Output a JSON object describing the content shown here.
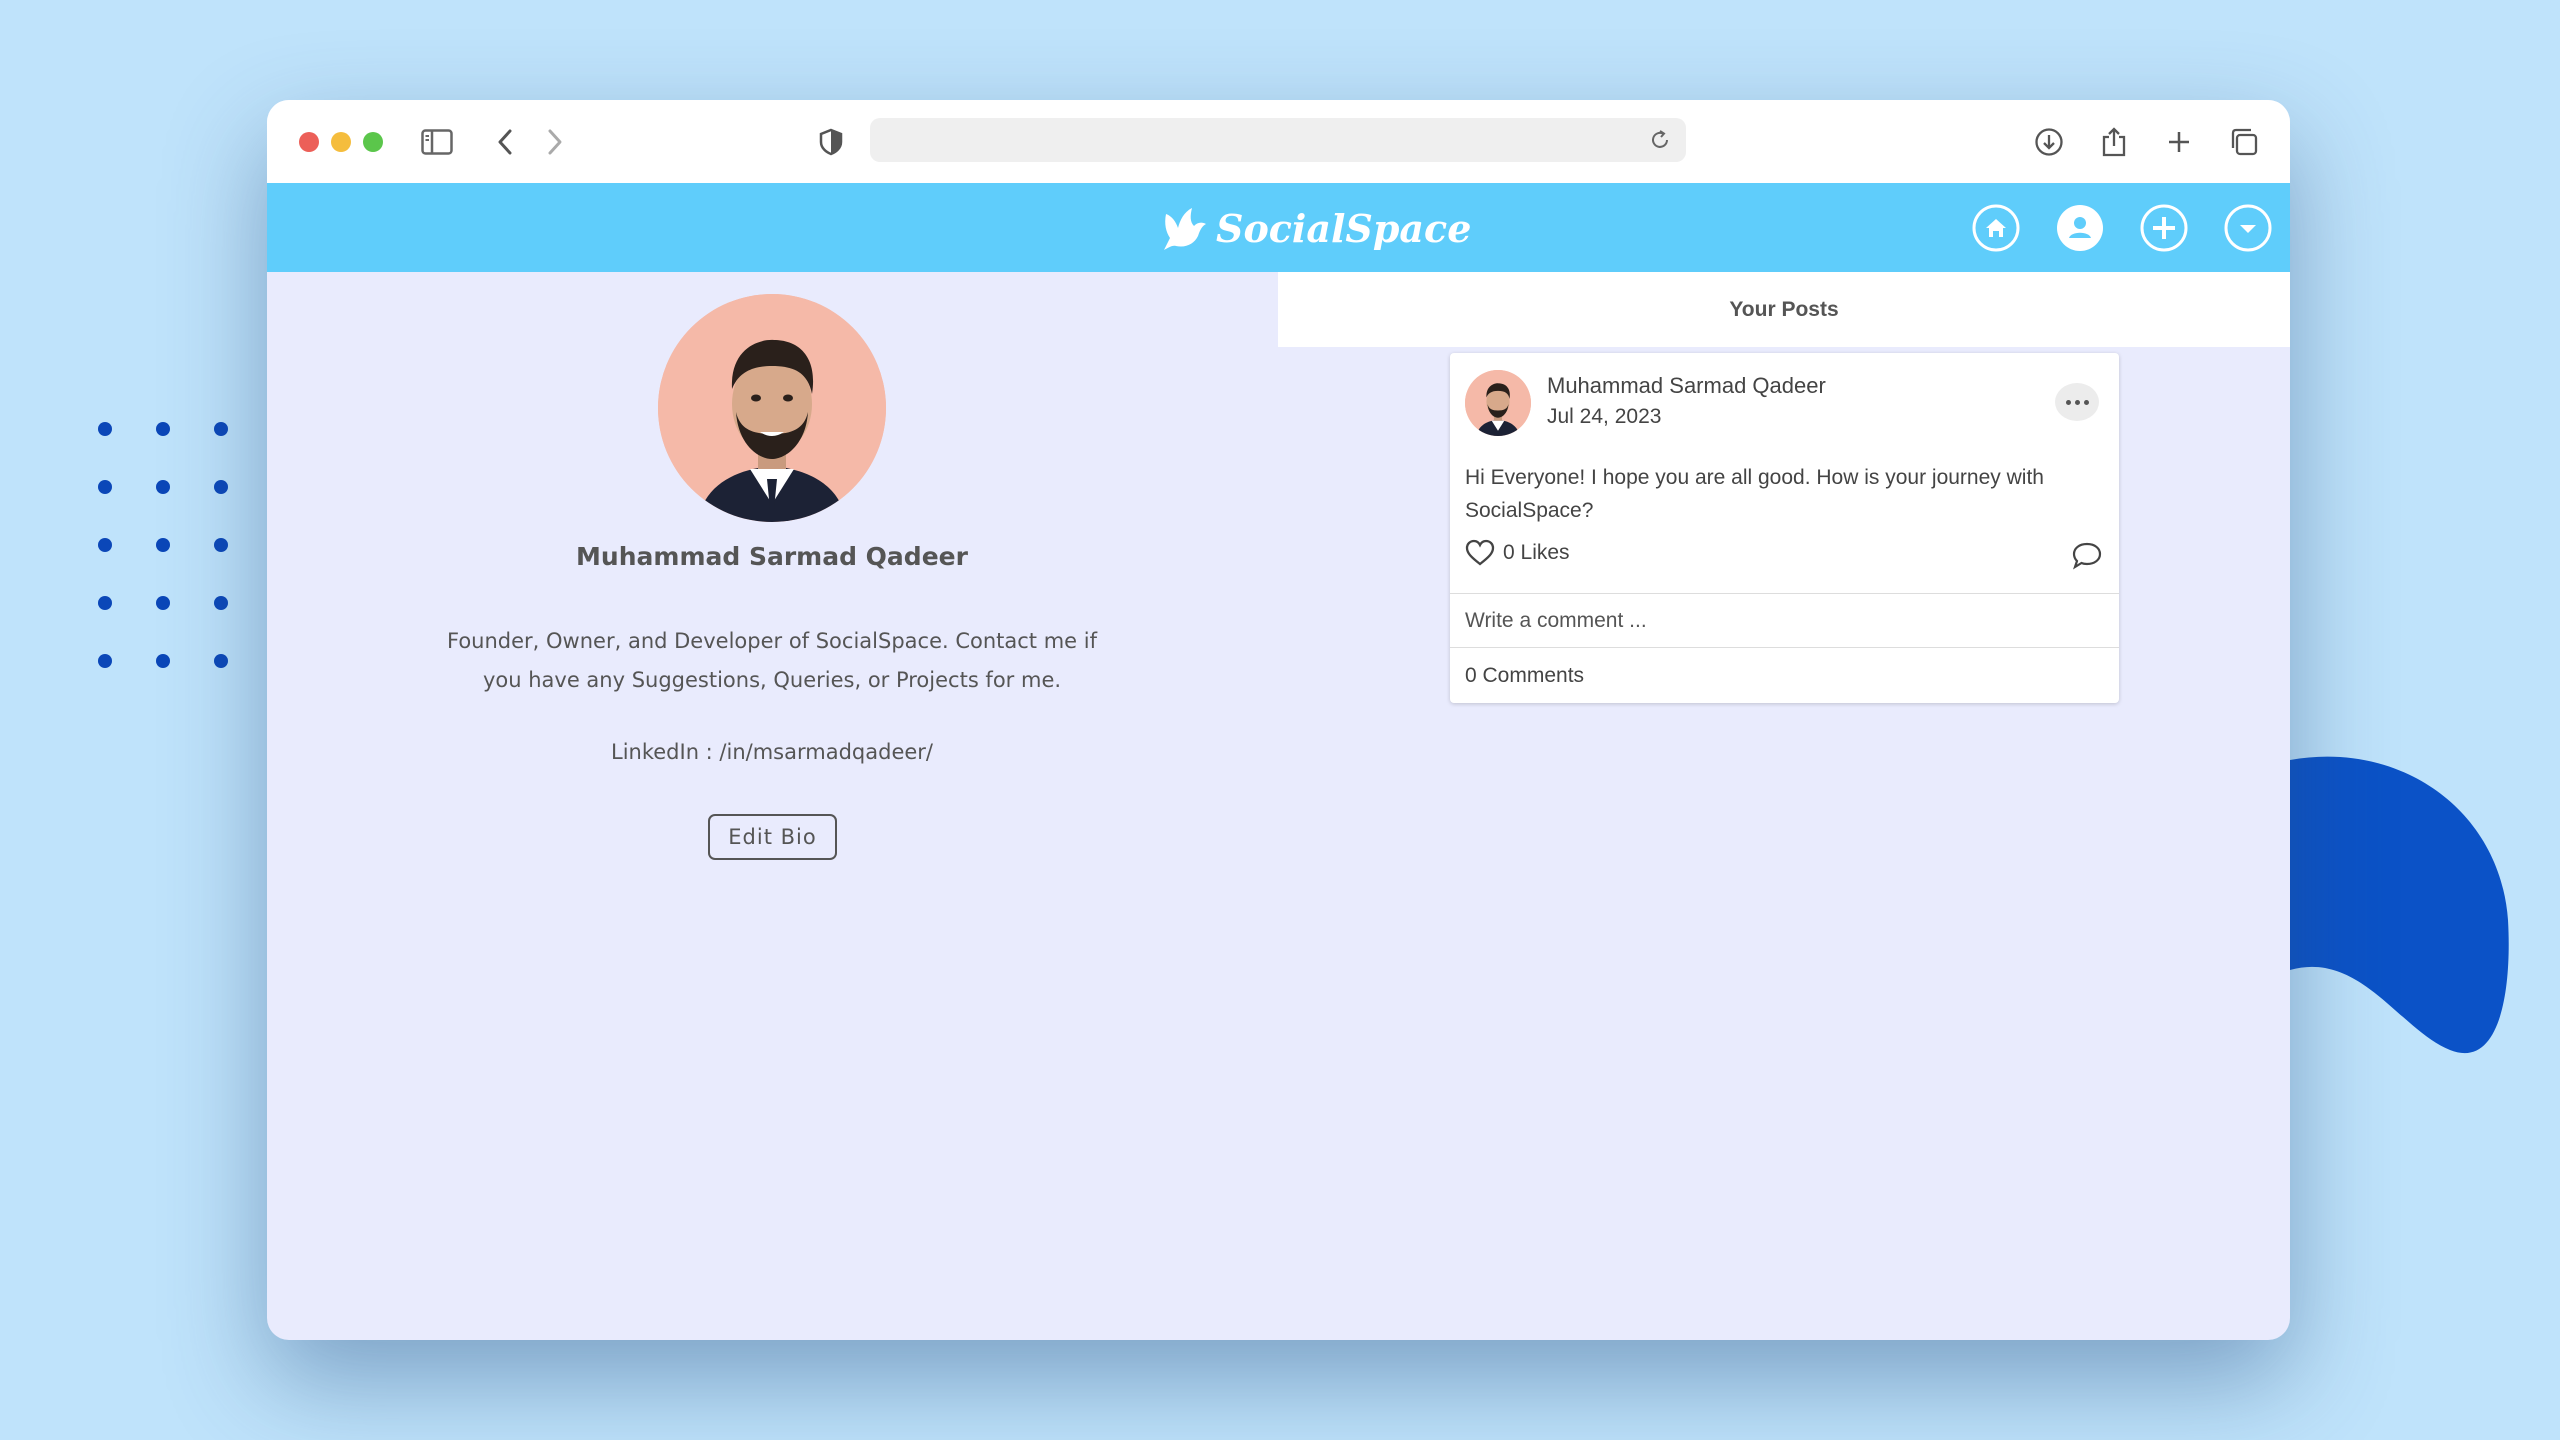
{
  "browser": {
    "url": "",
    "controls": [
      "sidebar-icon",
      "back-icon",
      "forward-icon",
      "privacy-shield-icon",
      "reload-icon",
      "download-icon",
      "share-icon",
      "new-tab-icon",
      "tabs-overview-icon"
    ]
  },
  "app": {
    "brand": "SocialSpace",
    "nav": [
      "home-icon",
      "profile-icon",
      "add-post-icon",
      "dropdown-icon"
    ],
    "colors": {
      "appbar": "#5fcdfb",
      "background": "#e9ebfd"
    }
  },
  "profile": {
    "name": "Muhammad Sarmad Qadeer",
    "bio": "Founder, Owner, and Developer of SocialSpace. Contact me if you have any Suggestions, Queries, or Projects for me.",
    "linkedin": "LinkedIn : /in/msarmadqadeer/",
    "edit_label": "Edit Bio"
  },
  "posts": {
    "heading": "Your Posts",
    "items": [
      {
        "author": "Muhammad Sarmad Qadeer",
        "date": "Jul 24, 2023",
        "text": "Hi Everyone! I hope you are all good. How is your journey with SocialSpace?",
        "likes": "0 Likes",
        "comment_placeholder": "Write a comment ...",
        "comments": "0 Comments"
      }
    ]
  }
}
